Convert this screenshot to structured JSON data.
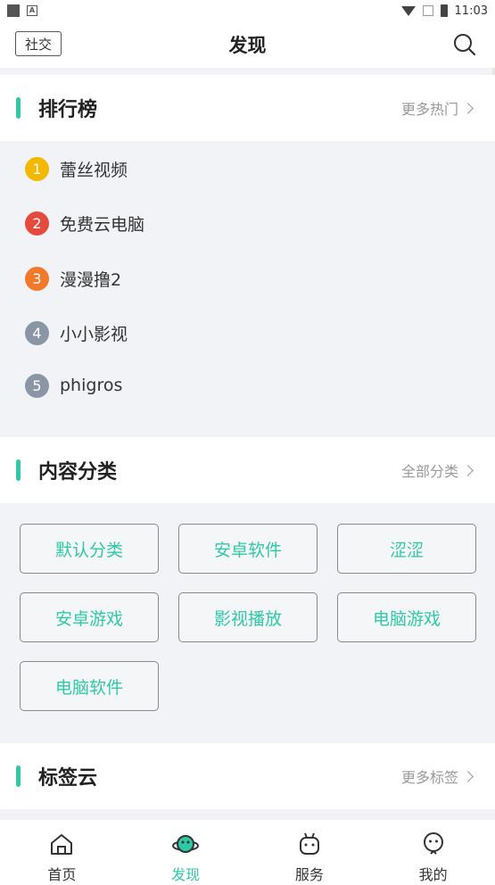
{
  "status_bar": {
    "time": "11:03"
  },
  "header": {
    "social_label": "社交",
    "title": "发现"
  },
  "ranking": {
    "title": "排行榜",
    "more": "更多热门",
    "items": [
      {
        "rank": "1",
        "label": "蕾丝视频",
        "color": "#f5b800"
      },
      {
        "rank": "2",
        "label": "免费云电脑",
        "color": "#e64a3c"
      },
      {
        "rank": "3",
        "label": "漫漫撸2",
        "color": "#f07a2a"
      },
      {
        "rank": "4",
        "label": "小小影视",
        "color": "#8a96a6"
      },
      {
        "rank": "5",
        "label": "phigros",
        "color": "#8a96a6"
      }
    ]
  },
  "categories": {
    "title": "内容分类",
    "more": "全部分类",
    "items": [
      "默认分类",
      "安卓软件",
      "涩涩",
      "安卓游戏",
      "影视播放",
      "电脑游戏",
      "电脑软件"
    ]
  },
  "tags": {
    "title": "标签云",
    "more": "更多标签"
  },
  "bottom_nav": {
    "items": [
      {
        "label": "首页",
        "icon": "home-icon"
      },
      {
        "label": "发现",
        "icon": "planet-icon"
      },
      {
        "label": "服务",
        "icon": "robot-icon"
      },
      {
        "label": "我的",
        "icon": "user-icon"
      }
    ]
  },
  "colors": {
    "accent": "#2ec9a6"
  }
}
